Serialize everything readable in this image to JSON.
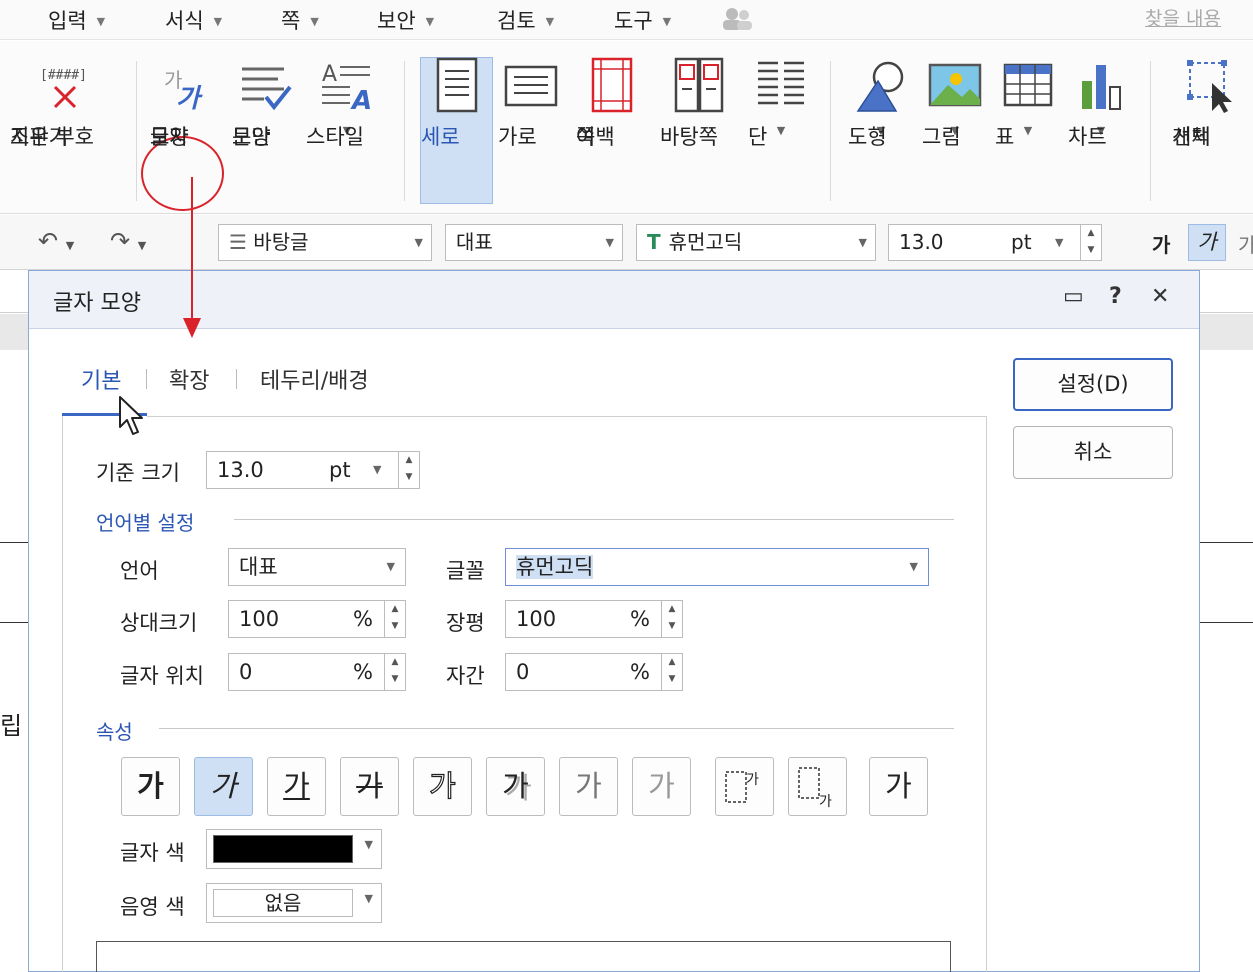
{
  "menu": {
    "items": [
      "입력",
      "서식",
      "쪽",
      "보안",
      "검토",
      "도구"
    ],
    "find_placeholder": "찾을 내용"
  },
  "ribbon": {
    "clear_marks": {
      "line1": "조판 부호",
      "line2": "지우기"
    },
    "char_shape": {
      "line1": "글자",
      "line2": "모양"
    },
    "para_shape": {
      "line1": "문단",
      "line2": "모양"
    },
    "style": "스타일",
    "portrait": "세로",
    "landscape": "가로",
    "margin": {
      "line1": "쪽",
      "line2": "여백"
    },
    "master_page": "바탕쪽",
    "columns": "단",
    "shape": "도형",
    "picture": "그림",
    "table": "표",
    "chart": "차트",
    "select_object": {
      "line1": "개체",
      "line2": "선택"
    }
  },
  "format_toolbar": {
    "style_name": "바탕글",
    "language": "대표",
    "font_name": "휴먼고딕",
    "font_size": "13.0",
    "font_unit": "pt",
    "bold": "가",
    "italic": "가"
  },
  "document": {
    "fragment": "립"
  },
  "dialog": {
    "title": "글자 모양",
    "tabs": [
      "기본",
      "확장",
      "테두리/배경"
    ],
    "ok_label": "설정(D)",
    "cancel_label": "취소",
    "base_size_label": "기준 크기",
    "base_size_value": "13.0",
    "base_size_unit": "pt",
    "lang_section": "언어별 설정",
    "language_label": "언어",
    "language_value": "대표",
    "font_label": "글꼴",
    "font_value": "휴먼고딕",
    "rel_size_label": "상대크기",
    "rel_size_value": "100",
    "width_label": "장평",
    "width_value": "100",
    "position_label": "글자 위치",
    "position_value": "0",
    "spacing_label": "자간",
    "spacing_value": "0",
    "percent": "%",
    "attr_section": "속성",
    "attr_glyph": "가",
    "text_color_label": "글자 색",
    "text_color": "#000000",
    "shade_color_label": "음영 색",
    "shade_color_value": "없음"
  },
  "icons": [
    "dropdown-icon",
    "spin-icon",
    "help-icon",
    "close-icon",
    "comment-icon",
    "undo-icon",
    "redo-icon",
    "mouse-cursor-icon"
  ]
}
